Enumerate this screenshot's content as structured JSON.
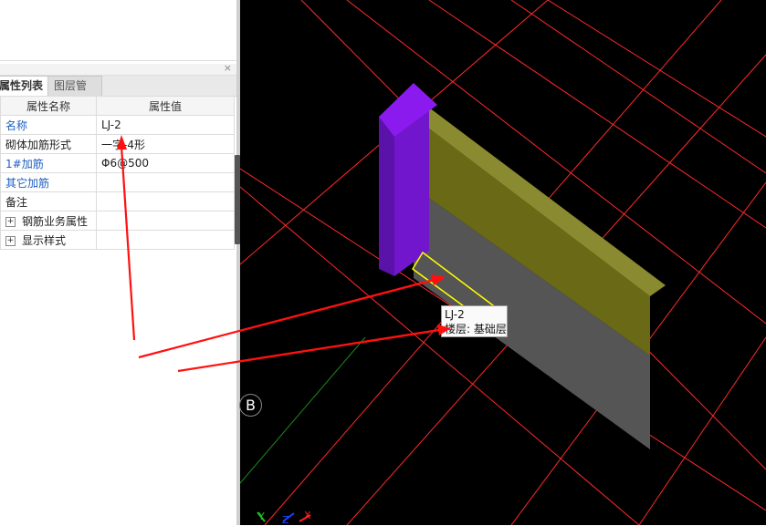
{
  "panel": {
    "tabs": [
      "属性列表",
      "图层管理"
    ],
    "close_glyph": "×",
    "columns": [
      "属性名称",
      "属性值"
    ],
    "rows": [
      {
        "name": "名称",
        "value": "LJ-2"
      },
      {
        "name": "砌体加筋形式",
        "value": "一字-4形"
      },
      {
        "name": "1#加筋",
        "value": "Φ6@500"
      },
      {
        "name": "其它加筋",
        "value": ""
      },
      {
        "name": "备注",
        "value": ""
      },
      {
        "name": "钢筋业务属性",
        "value": ""
      },
      {
        "name": "显示样式",
        "value": ""
      }
    ],
    "expand_glyph": "+"
  },
  "viewport": {
    "tooltip": {
      "line1": "LJ-2",
      "line2": "楼层: 基础层"
    },
    "axis_label": "B",
    "axis_triad": {
      "x": "X",
      "y": "Y",
      "z": "Z"
    },
    "colors": {
      "background": "#000000",
      "grid_lines": "#ff2020",
      "column": "#7a1fd6",
      "beam_top": "#6e6e1a",
      "wall": "#555555",
      "highlight": "#ffff00"
    }
  },
  "annotations": {
    "arrow_color": "#ff1010",
    "arrow_count": 3
  }
}
